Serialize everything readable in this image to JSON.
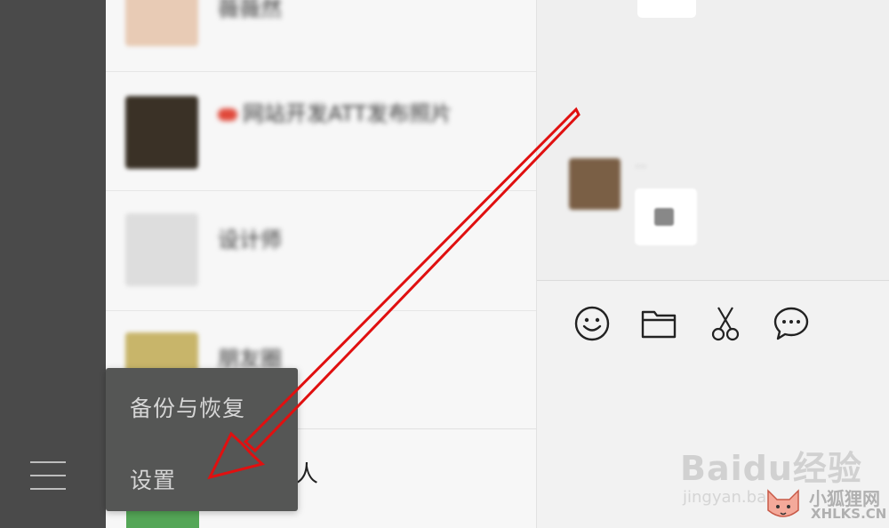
{
  "sidebar": {
    "menu_icon": "hamburger-icon"
  },
  "chat_list": {
    "items": [
      {
        "name": "薇薇然",
        "avatar_color": "#e8cbb5"
      },
      {
        "name": "网站开发ATT发布照片",
        "avatar_color": "#3a3126",
        "has_badge": true
      },
      {
        "name": "设计师",
        "avatar_color": "#dddddd"
      },
      {
        "name": "朋友圈",
        "avatar_color": "#c8b56a"
      }
    ],
    "partial_label": "人"
  },
  "popup_menu": {
    "items": [
      {
        "label": "备份与恢复"
      },
      {
        "label": "设置"
      }
    ]
  },
  "toolbar": {
    "icons": [
      "emoji-icon",
      "folder-icon",
      "scissors-icon",
      "chat-bubble-icon"
    ]
  },
  "watermark": {
    "brand": "Baidu经验",
    "sub": "jingyan.ba",
    "site_cn": "小狐狸网",
    "site_en": "XHLKS.CN"
  },
  "colors": {
    "sidebar": "#4a4a4a",
    "menu_bg": "#555655",
    "arrow": "#e01010",
    "green": "#54a657"
  }
}
